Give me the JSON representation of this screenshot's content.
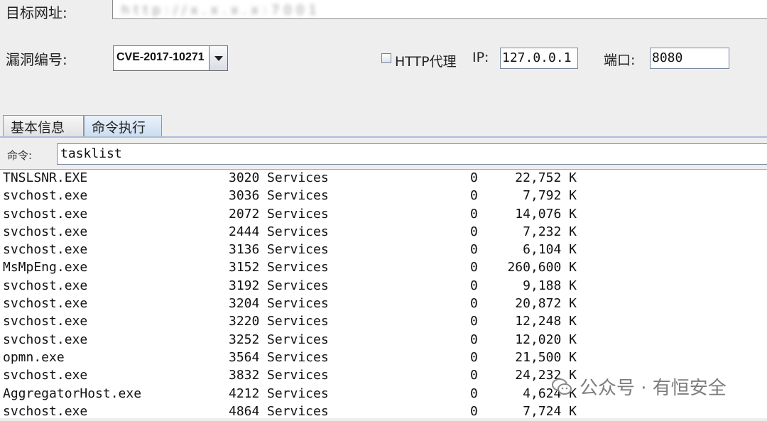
{
  "form": {
    "target_label": "目标网址:",
    "target_value": "http://x.x.x.x:7001",
    "vuln_label": "漏洞编号:",
    "vuln_selected": "CVE-2017-10271",
    "proxy_label": "HTTP代理",
    "ip_label": "IP:",
    "ip_value": "127.0.0.1",
    "port_label": "端口:",
    "port_value": "8080"
  },
  "tabs": [
    {
      "label": "基本信息"
    },
    {
      "label": "命令执行"
    }
  ],
  "command": {
    "label": "命令:",
    "value": "tasklist"
  },
  "output_rows": [
    {
      "name": "TNSLSNR.EXE",
      "pid": "3020",
      "session": "Services",
      "num": "0",
      "mem": "22,752 K"
    },
    {
      "name": "svchost.exe",
      "pid": "3036",
      "session": "Services",
      "num": "0",
      "mem": "7,792 K"
    },
    {
      "name": "svchost.exe",
      "pid": "2072",
      "session": "Services",
      "num": "0",
      "mem": "14,076 K"
    },
    {
      "name": "svchost.exe",
      "pid": "2444",
      "session": "Services",
      "num": "0",
      "mem": "7,232 K"
    },
    {
      "name": "svchost.exe",
      "pid": "3136",
      "session": "Services",
      "num": "0",
      "mem": "6,104 K"
    },
    {
      "name": "MsMpEng.exe",
      "pid": "3152",
      "session": "Services",
      "num": "0",
      "mem": "260,600 K"
    },
    {
      "name": "svchost.exe",
      "pid": "3192",
      "session": "Services",
      "num": "0",
      "mem": "9,188 K"
    },
    {
      "name": "svchost.exe",
      "pid": "3204",
      "session": "Services",
      "num": "0",
      "mem": "20,872 K"
    },
    {
      "name": "svchost.exe",
      "pid": "3220",
      "session": "Services",
      "num": "0",
      "mem": "12,248 K"
    },
    {
      "name": "svchost.exe",
      "pid": "3252",
      "session": "Services",
      "num": "0",
      "mem": "12,020 K"
    },
    {
      "name": "opmn.exe",
      "pid": "3564",
      "session": "Services",
      "num": "0",
      "mem": "21,500 K"
    },
    {
      "name": "svchost.exe",
      "pid": "3832",
      "session": "Services",
      "num": "0",
      "mem": "24,232 K"
    },
    {
      "name": "AggregatorHost.exe",
      "pid": "4212",
      "session": "Services",
      "num": "0",
      "mem": "4,624 K"
    },
    {
      "name": "svchost.exe",
      "pid": "4864",
      "session": "Services",
      "num": "0",
      "mem": "7,724 K"
    }
  ],
  "watermark": {
    "text": "公众号 · 有恒安全",
    "icon": "wechat-icon"
  }
}
